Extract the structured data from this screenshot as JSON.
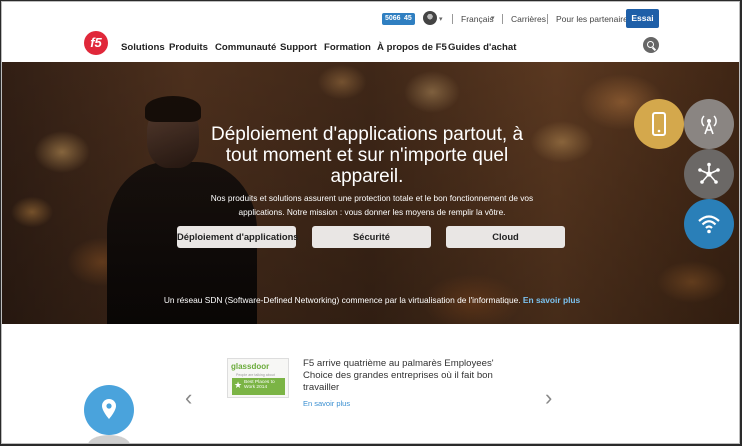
{
  "utility_bar": {
    "badges": [
      "5066",
      "45"
    ],
    "language": "Français",
    "careers": "Carrières",
    "partners": "Pour les partenaires",
    "trial": "Essai"
  },
  "brand": {
    "logo_text": "f5",
    "accent": "#e0283a"
  },
  "nav": {
    "items": [
      "Solutions",
      "Produits",
      "Communauté",
      "Support",
      "Formation",
      "À propos de F5",
      "Guides d'achat"
    ]
  },
  "hero": {
    "title": "Déploiement d'applications partout, à tout moment et sur n'importe quel appareil.",
    "subtitle": "Nos produits et solutions assurent une protection totale et le bon fonctionnement de vos applications. Notre mission : vous donner les moyens de remplir la vôtre.",
    "buttons": [
      "Déploiement d'applications",
      "Sécurité",
      "Cloud"
    ],
    "footer_text": "Un réseau SDN (Software-Defined Networking) commence par la virtualisation de l'informatique.",
    "footer_link": "En savoir plus"
  },
  "bubbles": [
    {
      "icon": "mobile-icon",
      "color": "#d4a84c"
    },
    {
      "icon": "antenna-icon",
      "color": "#8a8582"
    },
    {
      "icon": "network-icon",
      "color": "#6b6866"
    },
    {
      "icon": "wifi-icon",
      "color": "#2a7fb8"
    }
  ],
  "news": {
    "glassdoor_title": "glassdoor",
    "glassdoor_small": "People are talking about",
    "glassdoor_badge": "Best Places to Work 2014",
    "headline": "F5 arrive quatrième au palmarès Employees' Choice des grandes entreprises où il fait bon travailler",
    "more": "En savoir plus"
  },
  "icons": {
    "search": "search-icon",
    "arrow_left": "‹",
    "arrow_right": "›",
    "language_caret": "▾",
    "avatar_caret": "▾"
  }
}
